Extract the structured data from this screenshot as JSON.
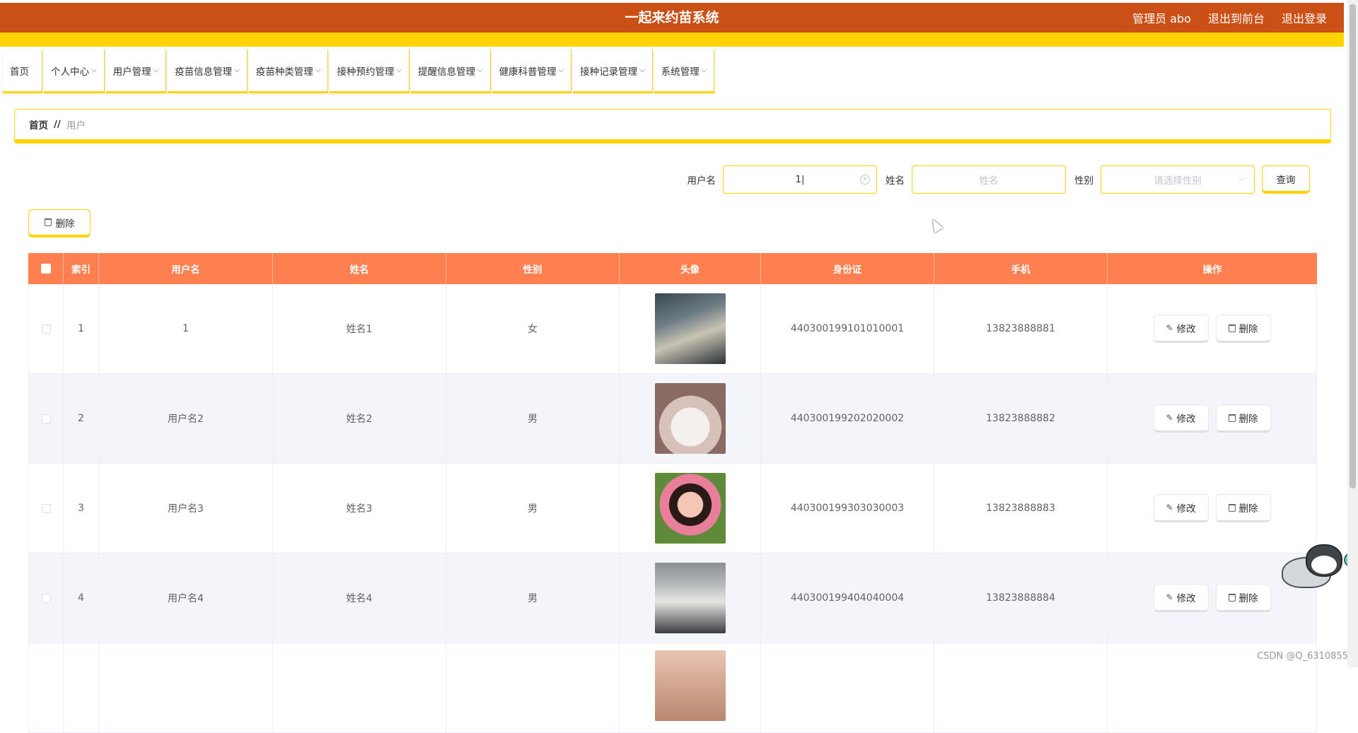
{
  "header": {
    "title": "一起来约苗系统",
    "user_label": "管理员 abo",
    "front_link": "退出到前台",
    "logout_link": "退出登录"
  },
  "nav": {
    "items": [
      {
        "label": "首页"
      },
      {
        "label": "个人中心"
      },
      {
        "label": "用户管理"
      },
      {
        "label": "疫苗信息管理"
      },
      {
        "label": "疫苗种类管理"
      },
      {
        "label": "接种预约管理"
      },
      {
        "label": "提醒信息管理"
      },
      {
        "label": "健康科普管理"
      },
      {
        "label": "接种记录管理"
      },
      {
        "label": "系统管理"
      }
    ]
  },
  "breadcrumb": {
    "home": "首页",
    "separator": "//",
    "current": "用户"
  },
  "search": {
    "username_label": "用户名",
    "username_value": "1",
    "name_label": "姓名",
    "name_placeholder": "姓名",
    "gender_label": "性别",
    "gender_placeholder": "请选择性别",
    "query_button": "查询"
  },
  "toolbar": {
    "delete_label": "删除"
  },
  "table": {
    "columns": [
      "索引",
      "用户名",
      "姓名",
      "性别",
      "头像",
      "身份证",
      "手机",
      "操作"
    ],
    "rows": [
      {
        "index": "1",
        "username": "1",
        "name": "姓名1",
        "gender": "女",
        "id_card": "440300199101010001",
        "phone": "13823888881"
      },
      {
        "index": "2",
        "username": "用户名2",
        "name": "姓名2",
        "gender": "男",
        "id_card": "440300199202020002",
        "phone": "13823888882"
      },
      {
        "index": "3",
        "username": "用户名3",
        "name": "姓名3",
        "gender": "男",
        "id_card": "440300199303030003",
        "phone": "13823888883"
      },
      {
        "index": "4",
        "username": "用户名4",
        "name": "姓名4",
        "gender": "男",
        "id_card": "440300199404040004",
        "phone": "13823888884"
      }
    ],
    "edit_label": "修改",
    "delete_label": "删除"
  },
  "watermark": "CSDN @Q_6310855",
  "colors": {
    "header_bg": "#cb5016",
    "accent_yellow": "#ffd300",
    "table_header_bg": "#fe7f4f",
    "row_alt_bg": "#f4f4fb"
  }
}
